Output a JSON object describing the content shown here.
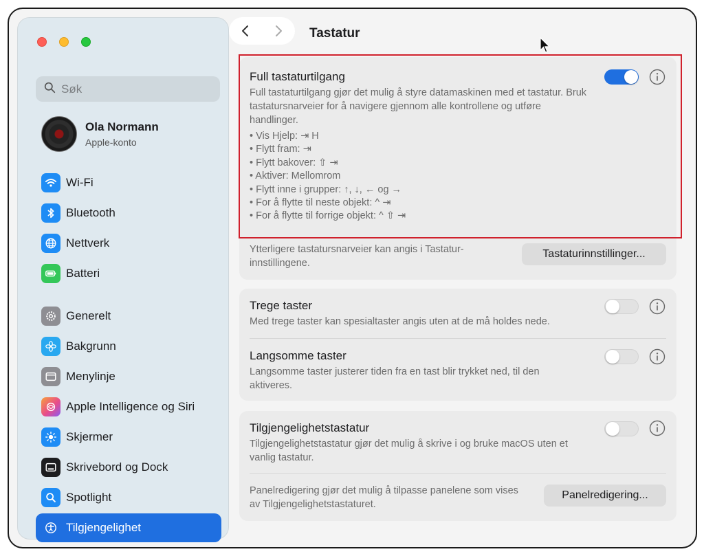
{
  "window": {
    "title": "Tastatur"
  },
  "sidebar": {
    "search_placeholder": "Søk",
    "profile": {
      "name": "Ola Normann",
      "subtitle": "Apple-konto"
    },
    "items": [
      {
        "label": "Wi-Fi",
        "icon": "wifi-icon",
        "color": "#1e8cf5"
      },
      {
        "label": "Bluetooth",
        "icon": "bluetooth-icon",
        "color": "#1e8cf5"
      },
      {
        "label": "Nettverk",
        "icon": "globe-icon",
        "color": "#1e8cf5"
      },
      {
        "label": "Batteri",
        "icon": "battery-icon",
        "color": "#34c759"
      },
      {
        "label": "Generelt",
        "icon": "gear-icon",
        "color": "#8e8e93"
      },
      {
        "label": "Bakgrunn",
        "icon": "flower-icon",
        "color": "#29a8f0"
      },
      {
        "label": "Menylinje",
        "icon": "menubar-icon",
        "color": "#8e8e93"
      },
      {
        "label": "Apple Intelligence og Siri",
        "icon": "siri-icon",
        "color": "#f08a3a"
      },
      {
        "label": "Skjermer",
        "icon": "sun-icon",
        "color": "#1e8cf5"
      },
      {
        "label": "Skrivebord og Dock",
        "icon": "dock-icon",
        "color": "#1d1d1f"
      },
      {
        "label": "Spotlight",
        "icon": "magnifier-icon",
        "color": "#1e8cf5"
      },
      {
        "label": "Tilgjengelighet",
        "icon": "accessibility-icon",
        "color": "#1f6fe0",
        "selected": true
      }
    ]
  },
  "main": {
    "full_access": {
      "title": "Full tastaturtilgang",
      "description": "Full tastaturtilgang gjør det mulig å styre datamaskinen med et tastatur. Bruk tastatursnarveier for å navigere gjennom alle kontrollene og utføre handlinger.",
      "enabled": true,
      "bullets": [
        "• Vis Hjelp: ⇥ H",
        "• Flytt fram: ⇥",
        "• Flytt bakover: ⇧ ⇥",
        "• Aktiver: Mellomrom",
        "• Flytt inne i grupper: ↑, ↓, ← og →",
        "• For å flytte til neste objekt: ^ ⇥",
        "• For å flytte til forrige objekt: ^ ⇧ ⇥"
      ],
      "more_text": "Ytterligere tastatursnarveier kan angis i Tastatur-innstillingene.",
      "settings_button": "Tastaturinnstillinger..."
    },
    "slow_keys": {
      "title": "Trege taster",
      "description": "Med trege taster kan spesialtaster angis uten at de må holdes nede.",
      "enabled": false
    },
    "sticky_keys": {
      "title": "Langsomme taster",
      "description": "Langsomme taster justerer tiden fra en tast blir trykket ned, til den aktiveres.",
      "enabled": false
    },
    "accessibility_keyboard": {
      "title": "Tilgjengelighetstastatur",
      "description": "Tilgjengelighetstastatur gjør det mulig å skrive i og bruke macOS uten et vanlig tastatur.",
      "enabled": false,
      "panel_text": "Panelredigering gjør det mulig å tilpasse panelene som vises av Tilgjengelighetstastaturet.",
      "panel_button": "Panelredigering..."
    }
  },
  "colors": {
    "accent": "#1f6fe0",
    "highlight": "#d0202c"
  }
}
